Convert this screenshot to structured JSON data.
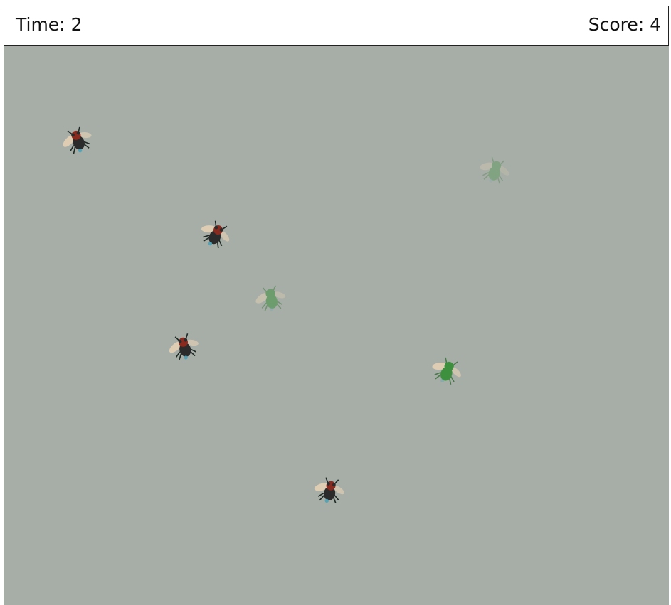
{
  "hud": {
    "time_label": "Time:",
    "time_value": "2",
    "score_label": "Score: 4"
  },
  "palette": {
    "field": "#a7aea7",
    "live_bug_body": "#2b2b2b",
    "live_bug_head": "#8a2a1e",
    "squashed_bug": "#3e8f3e",
    "wing": "#e8d2b4"
  },
  "bugs": [
    {
      "name": "bug-live",
      "state": "alive",
      "icon": "fly-icon"
    },
    {
      "name": "bug-squashed",
      "state": "squashed",
      "icon": "fly-squashed-icon"
    },
    {
      "name": "bug-live",
      "state": "alive",
      "icon": "fly-icon"
    },
    {
      "name": "bug-squashed",
      "state": "squashed",
      "icon": "fly-squashed-icon"
    },
    {
      "name": "bug-live",
      "state": "alive",
      "icon": "fly-icon"
    },
    {
      "name": "bug-squashed",
      "state": "squashed",
      "icon": "fly-squashed-icon"
    },
    {
      "name": "bug-live",
      "state": "alive",
      "icon": "fly-icon"
    }
  ]
}
